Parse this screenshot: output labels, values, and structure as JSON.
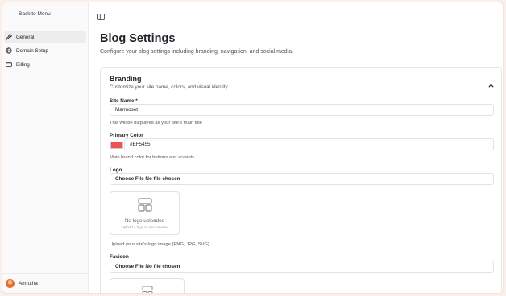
{
  "sidebar": {
    "back_label": "Back to Menu",
    "items": [
      {
        "label": "General",
        "icon": "wrench-icon",
        "active": true
      },
      {
        "label": "Domain Setup",
        "icon": "globe-icon",
        "active": false
      },
      {
        "label": "Billing",
        "icon": "card-icon",
        "active": false
      }
    ],
    "user_name": "Amrutha"
  },
  "page": {
    "title": "Blog Settings",
    "subtitle": "Configure your blog settings including branding, navigation, and social media."
  },
  "branding": {
    "title": "Branding",
    "description": "Customize your site name, colors, and visual identity",
    "site_name": {
      "label": "Site Name *",
      "value": "Marmoset",
      "help": "This will be displayed as your site's main title"
    },
    "primary_color": {
      "label": "Primary Color",
      "value": "#EF5455",
      "swatch": "#EF5455",
      "help": "Main brand color for buttons and accents"
    },
    "logo": {
      "label": "Logo",
      "file_text": "Choose File No file chosen",
      "empty_title": "No logo uploaded",
      "empty_hint": "Upload a logo to see preview",
      "help": "Upload your site's logo image (PNG, JPG, SVG)"
    },
    "favicon": {
      "label": "Favicon",
      "file_text": "Choose File No file chosen"
    }
  },
  "colors": {
    "accent": "#EF5455",
    "background": "#fbefea"
  }
}
